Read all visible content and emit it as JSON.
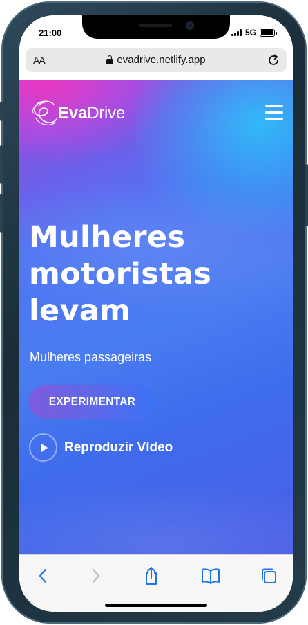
{
  "status_bar": {
    "time": "21:00",
    "network": "5G",
    "icons": [
      "signal-icon",
      "battery-icon"
    ]
  },
  "browser": {
    "text_size_label": "AA",
    "url": "evadrive.netlify.app",
    "icons": [
      "lock-icon",
      "reload-icon"
    ]
  },
  "page": {
    "logo": {
      "brand_bold": "Eva",
      "brand_light": "Drive",
      "icon": "evadrive-logo-icon"
    },
    "menu_icon": "hamburger-icon",
    "hero": {
      "title_lines": [
        "Mulheres",
        "motoristas",
        "levam"
      ],
      "subtitle": "Mulheres passageiras",
      "cta_label": "EXPERIMENTAR",
      "video_label": "Reproduzir Vídeo"
    }
  },
  "toolbar": {
    "items": [
      "back-icon",
      "forward-icon",
      "share-icon",
      "bookmarks-icon",
      "tabs-icon"
    ]
  },
  "colors": {
    "accent_blue": "#3a73f6",
    "accent_pink": "#ee37be",
    "accent_cyan": "#28c8fa",
    "toolbar_icon": "#1e74e8",
    "toolbar_icon_disabled": "#b8bcc4"
  }
}
